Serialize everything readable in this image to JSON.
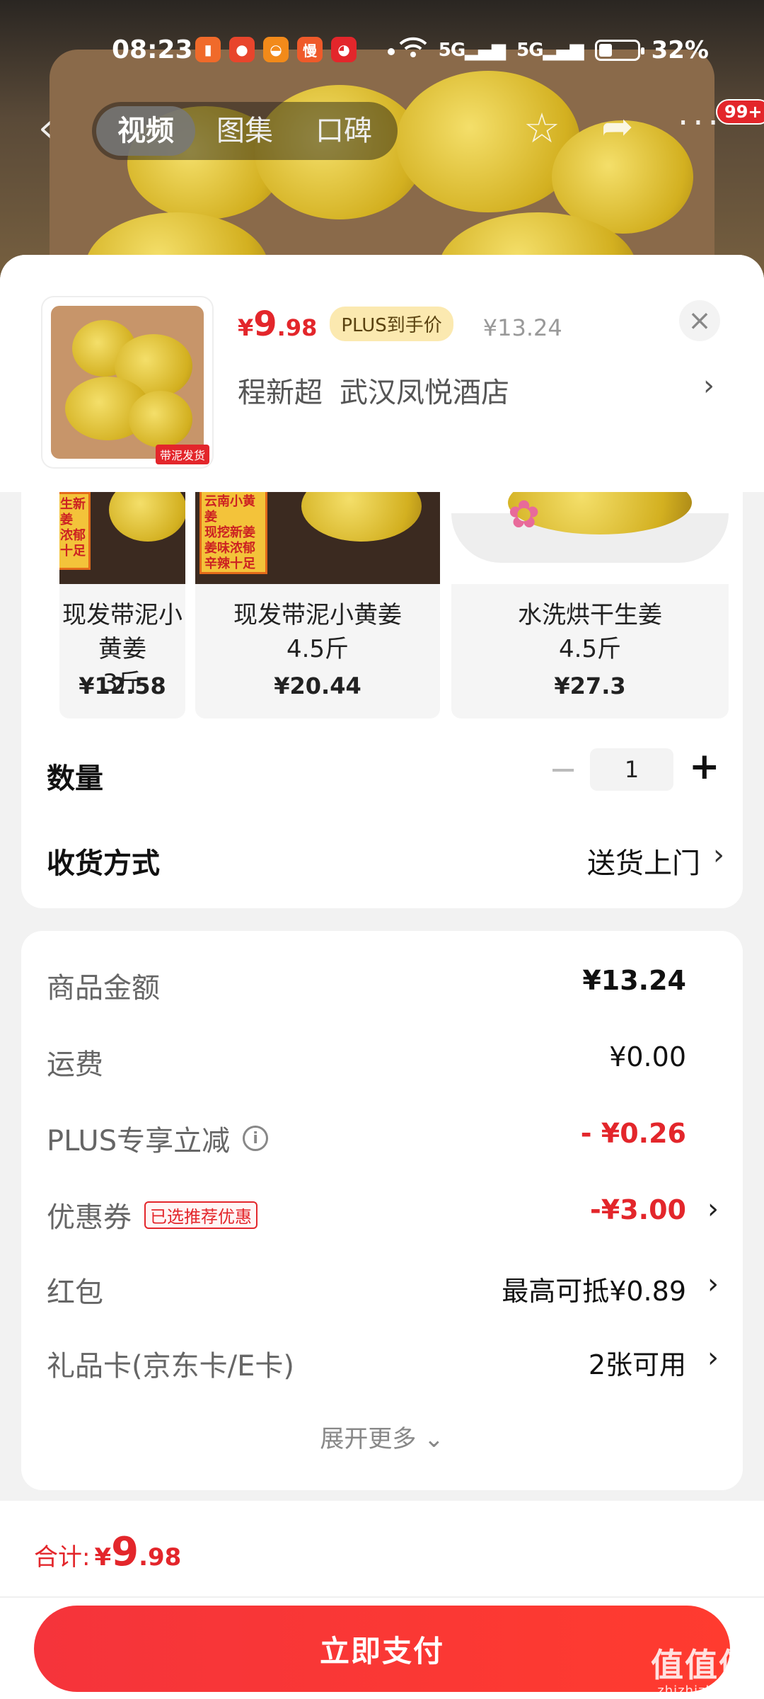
{
  "status_bar": {
    "time": "08:23",
    "apps": [
      {
        "icon": "book-app-icon",
        "glyph": "▮",
        "color": "#f06a2a"
      },
      {
        "icon": "tomato-app-icon",
        "glyph": "●",
        "color": "#e8452c"
      },
      {
        "icon": "orange-app-icon",
        "glyph": "◒",
        "color": "#f28a1a"
      },
      {
        "icon": "man-app-icon",
        "glyph": "慢",
        "color": "#ef5a2a"
      },
      {
        "icon": "jd-dog-app-icon",
        "glyph": "◕",
        "color": "#e3262b"
      }
    ],
    "signal_1": "5G",
    "signal_2": "5G",
    "battery": "32%"
  },
  "nav": {
    "back": "‹",
    "tabs": [
      "视频",
      "图集",
      "口碑"
    ],
    "active_tab": 0,
    "more": "···",
    "badge": "99+"
  },
  "product": {
    "thumb_tag": "带泥发货",
    "price_yen": "¥",
    "price_int": "9",
    "price_dec": ".98",
    "plus_label": "PLUS到手价",
    "original_price": "¥13.24",
    "close": "×",
    "recipient": "程新超",
    "address": "武汉凤悦酒店",
    "address_chevron": "›"
  },
  "variants": [
    {
      "sticker": "生新姜\n浓郁\n十足",
      "name": "现发带泥小黄姜\n3斤",
      "price": "¥12.58"
    },
    {
      "sticker": "云南小黄姜\n现挖新姜\n姜味浓郁\n辛辣十足",
      "name": "现发带泥小黄姜\n4.5斤",
      "price": "¥20.44"
    },
    {
      "sticker": "",
      "name": "水洗烘干生姜\n4.5斤",
      "price": "¥27.3"
    }
  ],
  "quantity": {
    "label": "数量",
    "minus": "−",
    "value": "1",
    "plus": "+"
  },
  "shipping": {
    "label": "收货方式",
    "value": "送货上门",
    "chevron": "›"
  },
  "summary": {
    "goods_label": "商品金额",
    "goods_value": "¥13.24",
    "freight_label": "运费",
    "freight_value": "¥0.00",
    "plus_label": "PLUS专享立减",
    "plus_info": "i",
    "plus_value": "- ¥0.26",
    "coupon_label": "优惠券",
    "coupon_tag": "已选推荐优惠",
    "coupon_value": "-¥3.00",
    "redpacket_label": "红包",
    "redpacket_value": "最高可抵¥0.89",
    "giftcard_label": "礼品卡(京东卡/E卡)",
    "giftcard_value": "2张可用",
    "chevron": "›",
    "expand": "展开更多 ⌄"
  },
  "footer": {
    "total_label": "合计:",
    "total_yen": "¥",
    "total_int": "9",
    "total_dec": ".98",
    "pay_button": "立即支付",
    "watermark": "值值值",
    "watermark_url": "zhizhizhi.com"
  },
  "colors": {
    "accent_red": "#e3262b",
    "plus_gold": "#fbe9b0"
  }
}
